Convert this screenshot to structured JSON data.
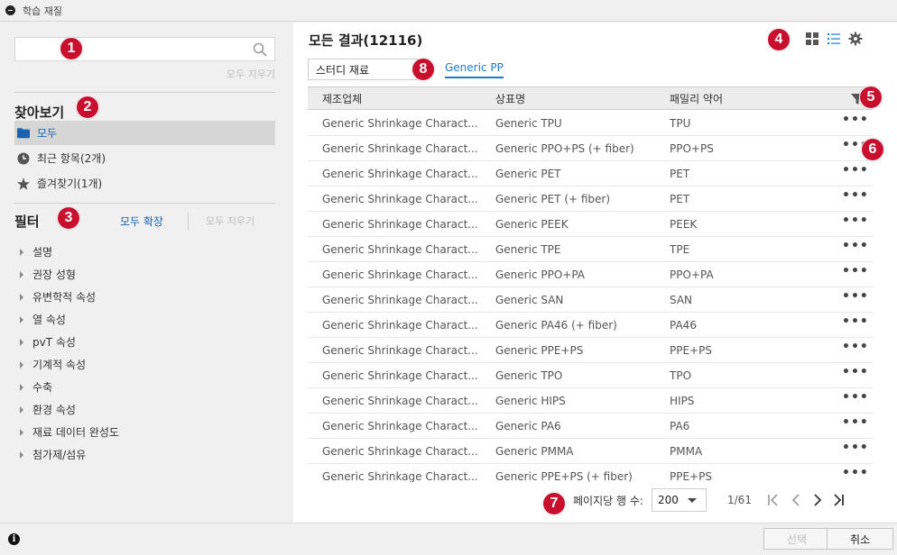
{
  "window": {
    "title": "학습 재질"
  },
  "sidebar": {
    "search": {
      "value": "",
      "placeholder": ""
    },
    "clear_all": "모두 지우기",
    "browse": {
      "title": "찾아보기",
      "items": [
        {
          "label": "모두",
          "icon": "folder-icon"
        },
        {
          "label": "최근 항목(2개)",
          "icon": "clock-icon"
        },
        {
          "label": "즐겨찾기(1개)",
          "icon": "star-icon"
        }
      ]
    },
    "filter": {
      "title": "필터",
      "expand_all": "모두 확장",
      "clear_all": "모두 지우기",
      "items": [
        "설명",
        "권장 성형",
        "유변학적 속성",
        "열 속성",
        "pvT 속성",
        "기계적 속성",
        "수축",
        "환경 속성",
        "재료 데이터 완성도",
        "첨가제/섬유"
      ]
    }
  },
  "main": {
    "title": "모든 결과(12116)",
    "study_material": "스터디 재료",
    "active_filter": "Generic PP",
    "columns": {
      "maker": "제조업체",
      "product": "상표명",
      "family": "패밀리 약어"
    },
    "more_label": "•••",
    "rows": [
      {
        "maker": "Generic Shrinkage Charact...",
        "product": "Generic TPU",
        "family": "TPU"
      },
      {
        "maker": "Generic Shrinkage Charact...",
        "product": "Generic PPO+PS (+ fiber)",
        "family": "PPO+PS"
      },
      {
        "maker": "Generic Shrinkage Charact...",
        "product": "Generic PET",
        "family": "PET"
      },
      {
        "maker": "Generic Shrinkage Charact...",
        "product": "Generic PET (+ fiber)",
        "family": "PET"
      },
      {
        "maker": "Generic Shrinkage Charact...",
        "product": "Generic PEEK",
        "family": "PEEK"
      },
      {
        "maker": "Generic Shrinkage Charact...",
        "product": "Generic TPE",
        "family": "TPE"
      },
      {
        "maker": "Generic Shrinkage Charact...",
        "product": "Generic PPO+PA",
        "family": "PPO+PA"
      },
      {
        "maker": "Generic Shrinkage Charact...",
        "product": "Generic SAN",
        "family": "SAN"
      },
      {
        "maker": "Generic Shrinkage Charact...",
        "product": "Generic PA46 (+ fiber)",
        "family": "PA46"
      },
      {
        "maker": "Generic Shrinkage Charact...",
        "product": "Generic PPE+PS",
        "family": "PPE+PS"
      },
      {
        "maker": "Generic Shrinkage Charact...",
        "product": "Generic TPO",
        "family": "TPO"
      },
      {
        "maker": "Generic Shrinkage Charact...",
        "product": "Generic HIPS",
        "family": "HIPS"
      },
      {
        "maker": "Generic Shrinkage Charact...",
        "product": "Generic PA6",
        "family": "PA6"
      },
      {
        "maker": "Generic Shrinkage Charact...",
        "product": "Generic PMMA",
        "family": "PMMA"
      },
      {
        "maker": "Generic Shrinkage Charact...",
        "product": "Generic PPE+PS (+ fiber)",
        "family": "PPE+PS"
      }
    ],
    "pager": {
      "rows_label": "페이지당 행 수:",
      "rows_value": "200",
      "page": "1/61"
    }
  },
  "footer": {
    "select": "선택",
    "cancel": "취소",
    "info": "i"
  },
  "badges": [
    "1",
    "2",
    "3",
    "4",
    "5",
    "6",
    "7",
    "8"
  ],
  "colors": {
    "accent": "#1c62ad",
    "badge": "#c8102e",
    "link": "#1c7ad0"
  }
}
